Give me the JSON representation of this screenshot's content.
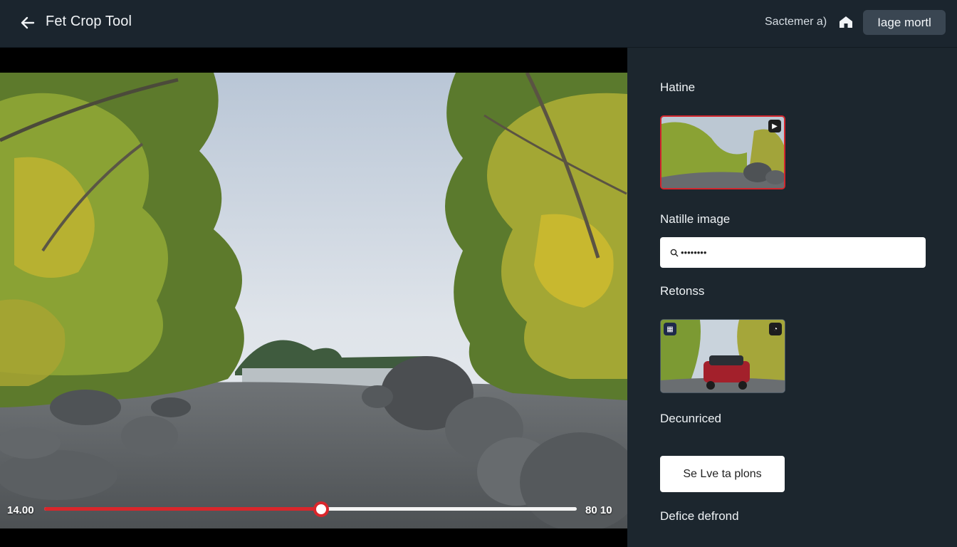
{
  "header": {
    "title": "Fet Crop Tool",
    "user_label": "Sactemer a)",
    "mode_button": "Iage mortl"
  },
  "player": {
    "time_start": "14.00",
    "time_end": "80 10",
    "progress": 0.52
  },
  "panel": {
    "section1_label": "Hatine",
    "section2_label": "Natille image",
    "search_value": "••••••••",
    "section3_label": "Retonss",
    "section4_label": "Decunriced",
    "action_button": "Se Lve ta plons",
    "footer_label": "Defice defrond"
  },
  "colors": {
    "accent": "#d9262b",
    "panel_bg": "#1c262e",
    "topbar_bg": "#1b252e"
  },
  "icons": [
    "back-arrow-icon",
    "home-icon",
    "search-icon",
    "play-icon",
    "grid-icon",
    "clock-icon"
  ]
}
